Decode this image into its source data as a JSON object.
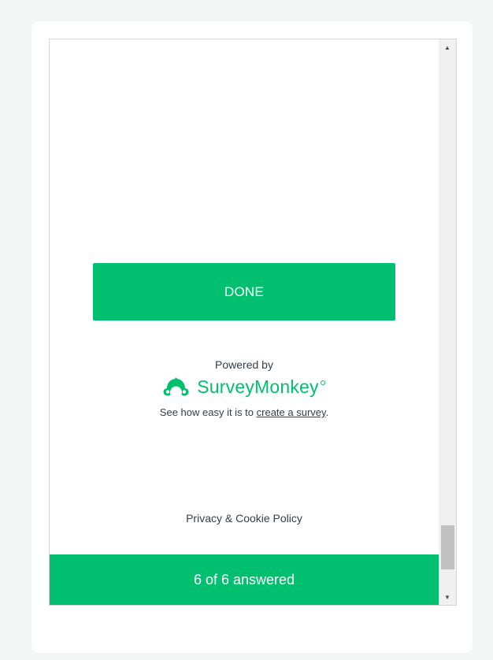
{
  "survey": {
    "done_label": "DONE",
    "powered_by": "Powered by",
    "brand_name": "SurveyMonkey",
    "tagline_prefix": "See how easy it is to ",
    "tagline_link": "create a survey",
    "tagline_suffix": ".",
    "privacy_label": "Privacy & Cookie Policy",
    "progress_label": "6 of 6 answered",
    "progress_answered": 6,
    "progress_total": 6
  },
  "scrollbar": {
    "up_icon": "▲",
    "down_icon": "▼"
  },
  "colors": {
    "brand_green": "#00bf6f",
    "text": "#333e48",
    "page_bg": "#f4f5f5"
  }
}
